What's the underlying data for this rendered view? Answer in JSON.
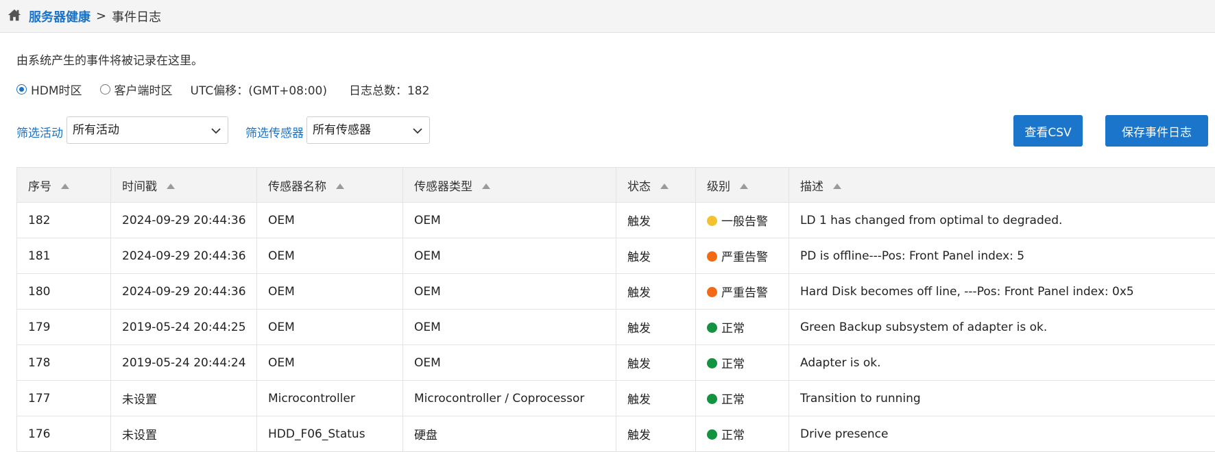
{
  "colors": {
    "accent": "#1a73c8",
    "button": "#1b76cb",
    "level_warning": "#f2c230",
    "level_critical": "#f26a13",
    "level_normal": "#13923f"
  },
  "breadcrumb": {
    "home_icon": "home-icon",
    "parent": "服务器健康",
    "separator": ">",
    "current": "事件日志"
  },
  "description": "由系统产生的事件将被记录在这里。",
  "timezone": {
    "options": [
      {
        "label": "HDM时区",
        "selected": true
      },
      {
        "label": "客户端时区",
        "selected": false
      }
    ],
    "utc_offset": "UTC偏移：(GMT+08:00)",
    "log_total": "日志总数：182"
  },
  "filters": {
    "activity_label": "筛选活动",
    "activity_value": "所有活动",
    "sensor_label": "筛选传感器",
    "sensor_value": "所有传感器"
  },
  "buttons": {
    "view_csv": "查看CSV",
    "save_log": "保存事件日志"
  },
  "table": {
    "columns": [
      "序号",
      "时间戳",
      "传感器名称",
      "传感器类型",
      "状态",
      "级别",
      "描述"
    ],
    "rows": [
      {
        "id": "182",
        "time": "2024-09-29 20:44:36",
        "sensor": "OEM",
        "type": "OEM",
        "state": "触发",
        "level": "一般告警",
        "level_color": "#f2c230",
        "desc": "LD 1 has changed from optimal to degraded."
      },
      {
        "id": "181",
        "time": "2024-09-29 20:44:36",
        "sensor": "OEM",
        "type": "OEM",
        "state": "触发",
        "level": "严重告警",
        "level_color": "#f26a13",
        "desc": "PD is offline---Pos: Front Panel index: 5"
      },
      {
        "id": "180",
        "time": "2024-09-29 20:44:36",
        "sensor": "OEM",
        "type": "OEM",
        "state": "触发",
        "level": "严重告警",
        "level_color": "#f26a13",
        "desc": "Hard Disk becomes off line, ---Pos: Front Panel index: 0x5"
      },
      {
        "id": "179",
        "time": "2019-05-24 20:44:25",
        "sensor": "OEM",
        "type": "OEM",
        "state": "触发",
        "level": "正常",
        "level_color": "#13923f",
        "desc": "Green Backup subsystem of adapter is ok."
      },
      {
        "id": "178",
        "time": "2019-05-24 20:44:24",
        "sensor": "OEM",
        "type": "OEM",
        "state": "触发",
        "level": "正常",
        "level_color": "#13923f",
        "desc": "Adapter is ok."
      },
      {
        "id": "177",
        "time": "未设置",
        "sensor": "Microcontroller",
        "type": "Microcontroller / Coprocessor",
        "state": "触发",
        "level": "正常",
        "level_color": "#13923f",
        "desc": "Transition to running"
      },
      {
        "id": "176",
        "time": "未设置",
        "sensor": "HDD_F06_Status",
        "type": "硬盘",
        "state": "触发",
        "level": "正常",
        "level_color": "#13923f",
        "desc": "Drive presence"
      }
    ]
  }
}
